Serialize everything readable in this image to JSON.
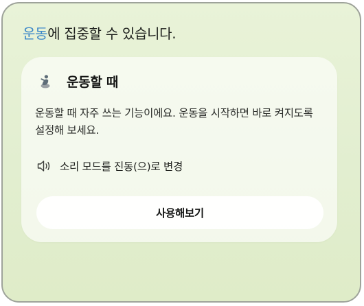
{
  "headline": {
    "accent": "운동",
    "rest": "에 집중할 수 있습니다."
  },
  "card": {
    "icon": "exercise-figure-icon",
    "title": "운동할 때",
    "description": "운동할 때 자주 쓰는 기능이에요. 운동을 시작하면 바로 켜지도록 설정해 보세요.",
    "feature": {
      "icon": "speaker-vibrate-icon",
      "label": "소리 모드를 진동(으)로 변경"
    },
    "button_label": "사용해보기"
  },
  "colors": {
    "accent": "#3b87c9",
    "background": "#e5f0d3",
    "card": "#f7faf1",
    "border": "#9ea39a"
  }
}
